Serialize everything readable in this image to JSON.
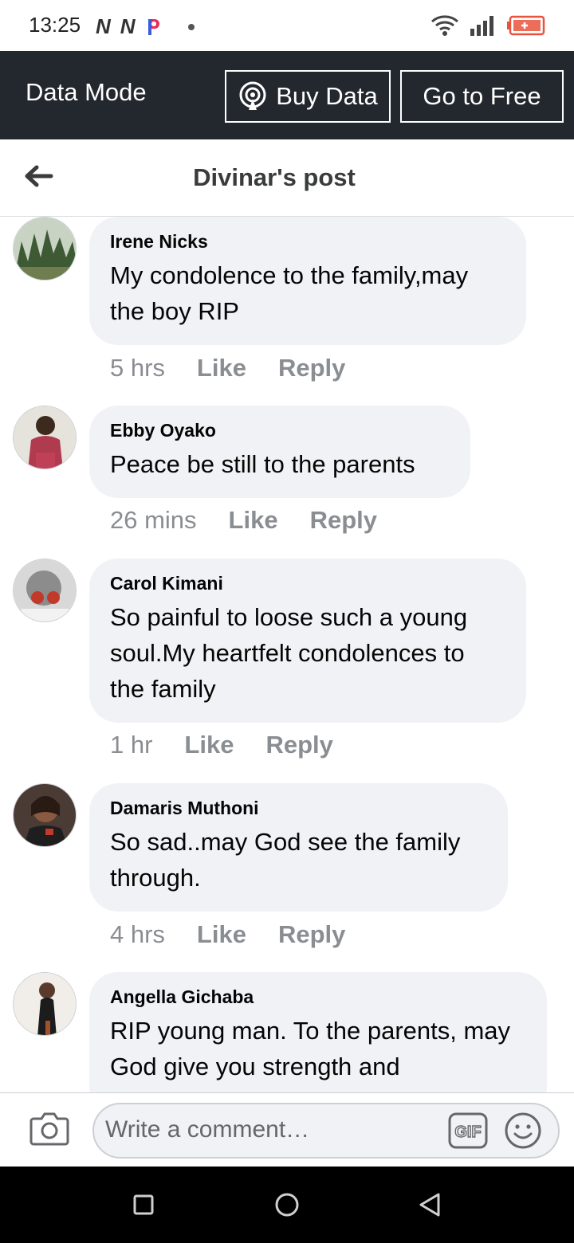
{
  "status": {
    "time": "13:25",
    "left_icons": [
      "n-icon",
      "n-icon",
      "p-icon",
      "dot-icon"
    ],
    "right_icons": [
      "wifi-icon",
      "signal-icon",
      "battery-icon"
    ],
    "battery_color": "#e8533d"
  },
  "data_bar": {
    "mode_label": "Data Mode",
    "buy_label": "Buy Data",
    "free_label": "Go to Free"
  },
  "header": {
    "title": "Divinar's post"
  },
  "comments": [
    {
      "author": "Irene Nicks",
      "text": "My condolence to the family,may the boy RIP",
      "time": "5 hrs",
      "like": "Like",
      "reply": "Reply"
    },
    {
      "author": "Ebby Oyako",
      "text": "Peace be still to the parents",
      "time": "26 mins",
      "like": "Like",
      "reply": "Reply"
    },
    {
      "author": "Carol Kimani",
      "text": "So painful to loose such a young soul.My heartfelt condolences to the family",
      "time": "1 hr",
      "like": "Like",
      "reply": "Reply"
    },
    {
      "author": "Damaris Muthoni",
      "text": "So sad..may God see the family through.",
      "time": "4 hrs",
      "like": "Like",
      "reply": "Reply"
    },
    {
      "author": "Angella Gichaba",
      "text": "RIP young man. To the parents, may God give you strength and"
    }
  ],
  "composer": {
    "placeholder": "Write a comment…"
  },
  "colors": {
    "bubble": "#f0f2f5",
    "meta": "#8a8d91",
    "data_bar": "#23272e"
  }
}
